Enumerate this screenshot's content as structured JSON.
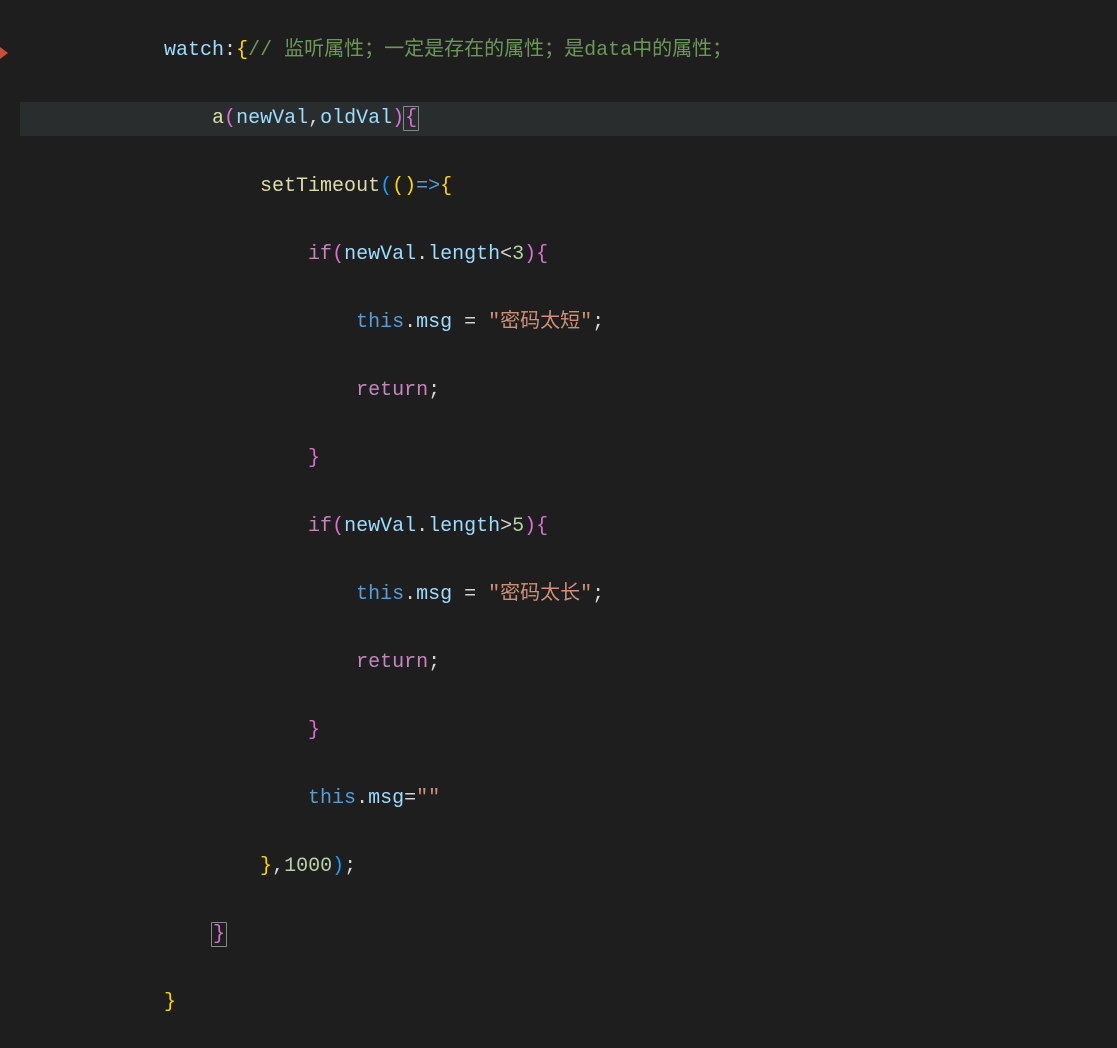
{
  "code": {
    "watch": "watch",
    "comment1": "// 监听属性；一定是存在的属性；是data中的属性；",
    "funcA": "a",
    "paramNewVal": "newVal",
    "paramOldVal": "oldVal",
    "setTimeout": "setTimeout",
    "arrow": "=>",
    "if1": "if",
    "length": "length",
    "lt3": "<",
    "num3": "3",
    "this1": "this",
    "msg": "msg",
    "eq": " = ",
    "str1": "\"密码太短\"",
    "return1": "return",
    "if2": "if",
    "gt5": ">",
    "num5": "5",
    "str2": "\"密码太长\"",
    "return2": "return",
    "strEmpty": "\"\"",
    "num1000": "1000"
  }
}
